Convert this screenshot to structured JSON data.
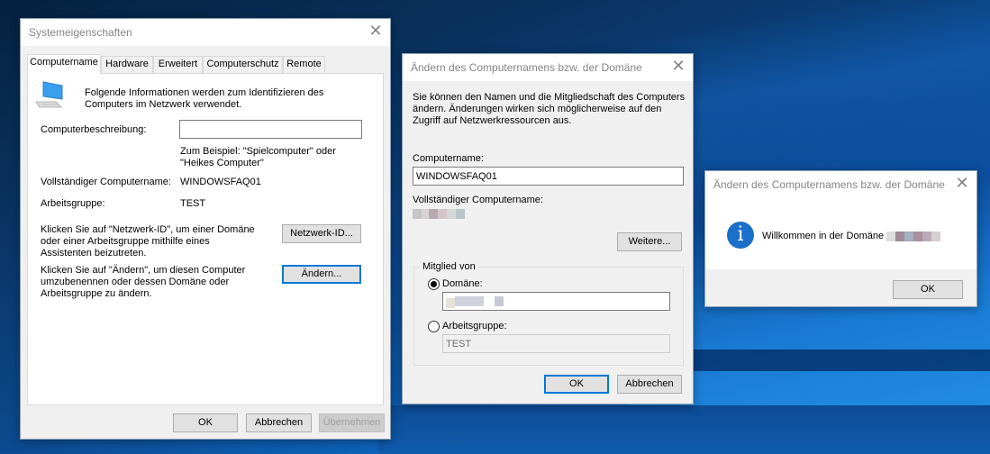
{
  "system_properties": {
    "title": "Systemeigenschaften",
    "tabs": [
      {
        "label": "Computername",
        "active": true
      },
      {
        "label": "Hardware",
        "active": false
      },
      {
        "label": "Erweitert",
        "active": false
      },
      {
        "label": "Computerschutz",
        "active": false
      },
      {
        "label": "Remote",
        "active": false
      }
    ],
    "intro": "Folgende Informationen werden zum Identifizieren des Computers im Netzwerk verwendet.",
    "description_label": "Computerbeschreibung:",
    "description_value": "",
    "description_hint": "Zum Beispiel: \"Spielcomputer\" oder \"Heikes Computer\"",
    "full_name_label": "Vollständiger Computername:",
    "full_name_value": "WINDOWSFAQ01",
    "workgroup_label": "Arbeitsgruppe:",
    "workgroup_value": "TEST",
    "network_id_text": "Klicken Sie auf \"Netzwerk-ID\", um einer Domäne oder einer Arbeitsgruppe mithilfe eines Assistenten beizutreten.",
    "network_id_button": "Netzwerk-ID...",
    "change_text": "Klicken Sie auf \"Ändern\", um diesen Computer umzubenennen oder dessen Domäne oder Arbeitsgruppe zu ändern.",
    "change_button": "Ändern...",
    "ok_button": "OK",
    "cancel_button": "Abbrechen",
    "apply_button": "Übernehmen"
  },
  "rename_dialog": {
    "title": "Ändern des Computernamens bzw. der Domäne",
    "intro": "Sie können den Namen und die Mitgliedschaft des Computers ändern. Änderungen wirken sich möglicherweise auf den Zugriff auf Netzwerkressourcen aus.",
    "computer_name_label": "Computername:",
    "computer_name_value": "WINDOWSFAQ01",
    "full_name_label": "Vollständiger Computername:",
    "full_name_value": "(redacted)",
    "more_button": "Weitere...",
    "member_of_legend": "Mitglied von",
    "domain_label": "Domäne:",
    "domain_selected": true,
    "domain_value": "(redacted)",
    "workgroup_label": "Arbeitsgruppe:",
    "workgroup_selected": false,
    "workgroup_value": "TEST",
    "ok_button": "OK",
    "cancel_button": "Abbrechen"
  },
  "welcome_dialog": {
    "title": "Ändern des Computernamens bzw. der Domäne",
    "message": "Willkommen in der Domäne",
    "domain_value": "(redacted)",
    "ok_button": "OK",
    "icon": "info-icon"
  }
}
